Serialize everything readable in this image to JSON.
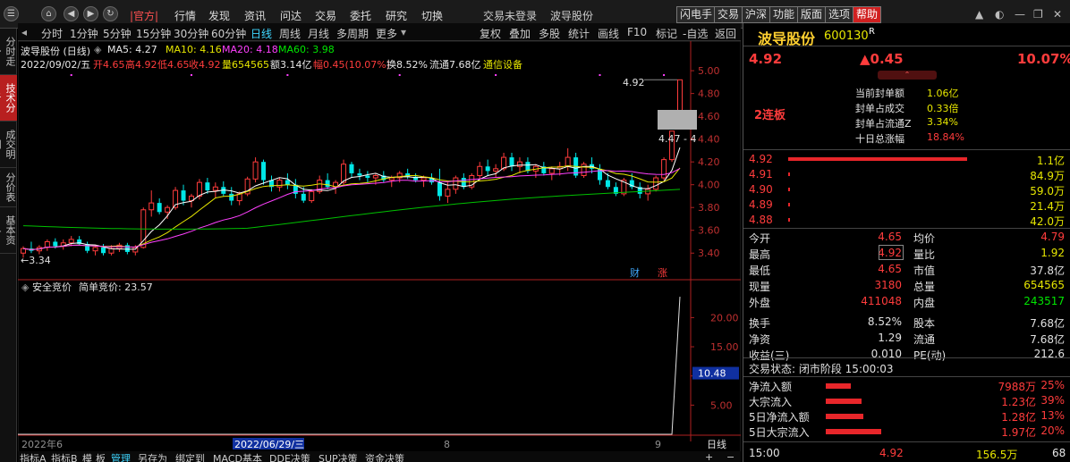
{
  "topbar": {
    "menu": [
      "行情",
      "发现",
      "资讯",
      "问达",
      "交易",
      "委托",
      "研究",
      "切换"
    ],
    "official": "|官方|",
    "status": "交易未登录",
    "stock_name": "波导股份",
    "buttons": [
      "闪电手",
      "交易",
      "沪深",
      "功能",
      "版面",
      "选项",
      "帮助"
    ]
  },
  "left_tabs": [
    "分时走势",
    "技术分析",
    "成交明细",
    "分价表",
    "基本资料"
  ],
  "timeframes": [
    "分时",
    "1分钟",
    "5分钟",
    "15分钟",
    "30分钟",
    "60分钟",
    "日线",
    "周线",
    "月线",
    "多周期",
    "更多"
  ],
  "toolbar": [
    "复权",
    "叠加",
    "多股",
    "统计",
    "画线",
    "F10",
    "标记",
    "-自选",
    "返回"
  ],
  "indicators": {
    "title": "波导股份 (日线)",
    "ma5": "MA5: 4.27",
    "ma10": "MA10: 4.16",
    "ma20": "MA20: 4.18",
    "ma60": "MA60: 3.98"
  },
  "ohlc": {
    "date": "2022/09/02/五",
    "open": "开4.65",
    "high": "高4.92",
    "low": "低4.65",
    "close": "收4.92",
    "vol": "量654565",
    "amount": "额3.14亿",
    "change": "幅0.45(10.07%)",
    "turnover": "换8.52%",
    "float": "流通7.68亿",
    "sector": "通信设备"
  },
  "price_axis": [
    "5.00",
    "4.80",
    "4.60",
    "4.40",
    "4.20",
    "4.00",
    "3.80",
    "3.60",
    "3.40"
  ],
  "price_labels": {
    "high": "4.92",
    "low": "3.34",
    "marker": "4.47 - 4"
  },
  "badges": {
    "fin": "财",
    "zhang": "涨"
  },
  "sub_indicator": {
    "title": "安全竞价",
    "value": "简单竞价: 23.57",
    "axis": [
      "20.00",
      "15.00",
      "10.00",
      "5.00"
    ],
    "current": "10.48"
  },
  "date_axis": {
    "left": "2022年6",
    "highlight": "2022/06/29/三",
    "mid": "8",
    "right": "9",
    "period": "日线"
  },
  "bottom_tabs": [
    "指标A",
    "指标B",
    "模",
    "板",
    "管理",
    "另存为",
    "绑定到",
    "MACD基本",
    "DDE决策",
    "SUP决策",
    "资金决策"
  ],
  "quote": {
    "name": "波导股份",
    "code": "600130",
    "flag": "R",
    "price": "4.92",
    "change": "▲0.45",
    "pct": "10.07%",
    "streak": "2连板",
    "seal": [
      [
        "当前封单额",
        "1.06亿"
      ],
      [
        "封单占成交",
        "0.33倍"
      ],
      [
        "封单占流通Z",
        "3.34%"
      ],
      [
        "十日总涨幅",
        "18.84%"
      ]
    ],
    "bids": [
      [
        "4.92",
        "1.1亿"
      ],
      [
        "4.91",
        "84.9万"
      ],
      [
        "4.90",
        "59.0万"
      ],
      [
        "4.89",
        "21.4万"
      ],
      [
        "4.88",
        "42.0万"
      ]
    ],
    "stats": [
      [
        "今开",
        "4.65",
        "均价",
        "4.79"
      ],
      [
        "最高",
        "4.92",
        "量比",
        "1.92"
      ],
      [
        "最低",
        "4.65",
        "市值",
        "37.8亿"
      ],
      [
        "现量",
        "3180",
        "总量",
        "654565"
      ],
      [
        "外盘",
        "411048",
        "内盘",
        "243517"
      ],
      [
        "换手",
        "8.52%",
        "股本",
        "7.68亿"
      ],
      [
        "净资",
        "1.29",
        "流通",
        "7.68亿"
      ],
      [
        "收益(三)",
        "0.010",
        "PE(动)",
        "212.6"
      ]
    ],
    "trade_status": "交易状态: 闭市阶段 15:00:03",
    "flows": [
      [
        "净流入额",
        "7988万",
        "25%"
      ],
      [
        "大宗流入",
        "1.23亿",
        "39%"
      ],
      [
        "5日净流入额",
        "1.28亿",
        "13%"
      ],
      [
        "5日大宗流入",
        "1.97亿",
        "20%"
      ]
    ],
    "last": {
      "time": "15:00",
      "price": "4.92",
      "vol": "156.5万",
      "num": "68"
    }
  },
  "colors": {
    "up": "#ff3c3c",
    "down": "#00e6e6",
    "ma5": "#ffffff",
    "ma10": "#e6e600",
    "ma20": "#ff40ff",
    "ma60": "#00c000"
  }
}
